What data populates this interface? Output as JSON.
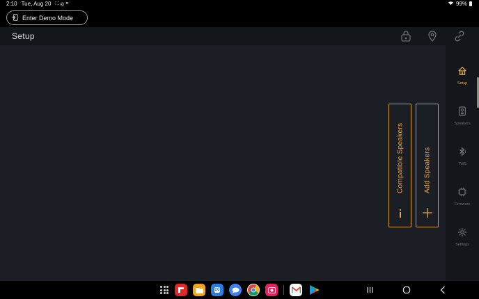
{
  "status_bar": {
    "time": "2:10",
    "date": "Tue, Aug 20",
    "battery": "99%"
  },
  "demo_button": {
    "label": "Enter Demo Mode"
  },
  "header": {
    "title": "Setup",
    "icons": [
      "lock-speaker-icon",
      "location-pin-icon",
      "link-icon"
    ]
  },
  "cards": [
    {
      "label": "Compatible Speakers",
      "glyph": "i"
    },
    {
      "label": "Add Speakers",
      "glyph": "+"
    }
  ],
  "sidebar": {
    "items": [
      {
        "label": "Setup",
        "icon": "home-icon",
        "active": true
      },
      {
        "label": "Speakers",
        "icon": "speaker-icon",
        "active": false
      },
      {
        "label": "TWS",
        "icon": "bluetooth-icon",
        "active": false
      },
      {
        "label": "Firmware",
        "icon": "chip-icon",
        "active": false
      },
      {
        "label": "Settings",
        "icon": "gear-icon",
        "active": false
      }
    ]
  },
  "dock": {
    "calendar_day": "20",
    "apps": [
      "apps-grid-icon",
      "flipboard-icon",
      "files-icon",
      "calendar-icon",
      "messages-icon",
      "chrome-icon",
      "screen-recorder-icon",
      "gmail-icon",
      "play-store-icon"
    ]
  },
  "colors": {
    "accent": "#e4a849",
    "background": "#1b1e25",
    "panel": "#13161a"
  }
}
